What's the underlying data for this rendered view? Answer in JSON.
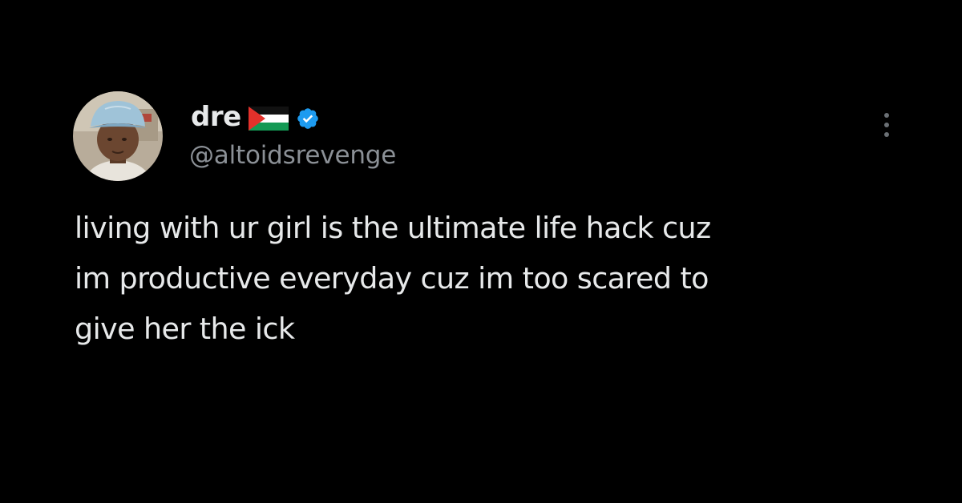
{
  "theme": {
    "background": "#000000",
    "text_primary": "#e7e9ea",
    "text_secondary": "#8b9096",
    "verified_blue": "#1d9bf0"
  },
  "author": {
    "display_name": "dre",
    "flag_icon": "palestine-flag-icon",
    "verified_icon": "verified-badge-icon",
    "handle": "@altoidsrevenge",
    "avatar_icon": "user-avatar"
  },
  "actions": {
    "more_icon": "more-vertical-icon"
  },
  "tweet": {
    "lines": [
      "living with ur girl is the ultimate life hack cuz",
      "im productive everyday cuz im too scared to",
      "give her the ick"
    ]
  }
}
